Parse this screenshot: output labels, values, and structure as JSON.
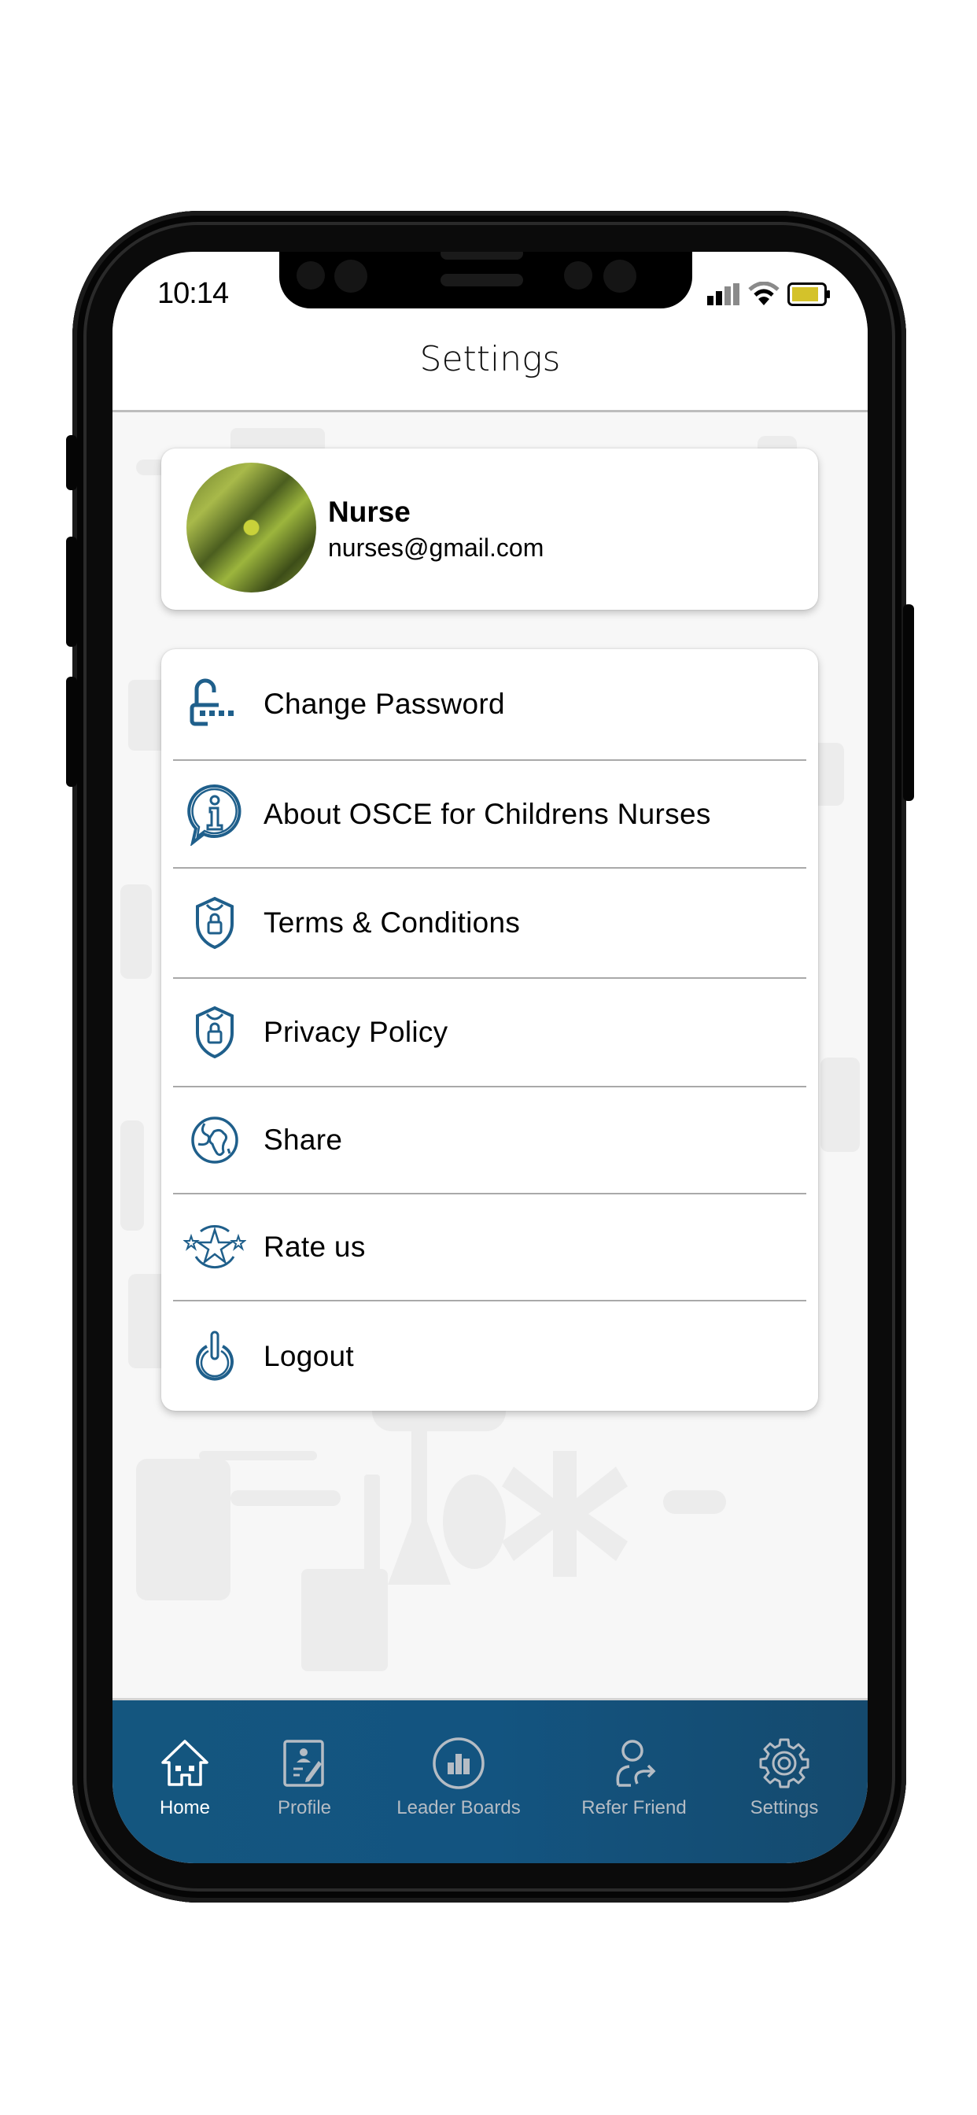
{
  "status_bar": {
    "time": "10:14",
    "signal_icon": "cellular-signal-icon",
    "wifi_icon": "wifi-icon",
    "battery_icon": "battery-icon",
    "battery_color": "#d4c22a"
  },
  "header": {
    "title": "Settings"
  },
  "profile": {
    "name": "Nurse",
    "email": "nurses@gmail.com",
    "avatar_icon": "avatar-photo"
  },
  "menu": {
    "items": [
      {
        "label": "Change Password",
        "icon": "unlock-password-icon"
      },
      {
        "label": "About OSCE for Childrens Nurses",
        "icon": "info-chat-icon"
      },
      {
        "label": "Terms & Conditions",
        "icon": "shield-lock-icon"
      },
      {
        "label": "Privacy Policy",
        "icon": "shield-lock-icon"
      },
      {
        "label": "Share",
        "icon": "globe-icon"
      },
      {
        "label": "Rate us",
        "icon": "stars-icon"
      },
      {
        "label": "Logout",
        "icon": "power-icon"
      }
    ]
  },
  "tabbar": {
    "active": "Home",
    "items": [
      {
        "label": "Home",
        "icon": "home-icon"
      },
      {
        "label": "Profile",
        "icon": "profile-document-icon"
      },
      {
        "label": "Leader Boards",
        "icon": "bar-chart-icon"
      },
      {
        "label": "Refer Friend",
        "icon": "refer-user-icon"
      },
      {
        "label": "Settings",
        "icon": "gear-icon"
      }
    ]
  },
  "colors": {
    "accent_icon": "#1f5f8b",
    "tabbar_bg": "#14567f",
    "tab_active": "#ffffff",
    "tab_inactive": "#b5bcc4"
  }
}
